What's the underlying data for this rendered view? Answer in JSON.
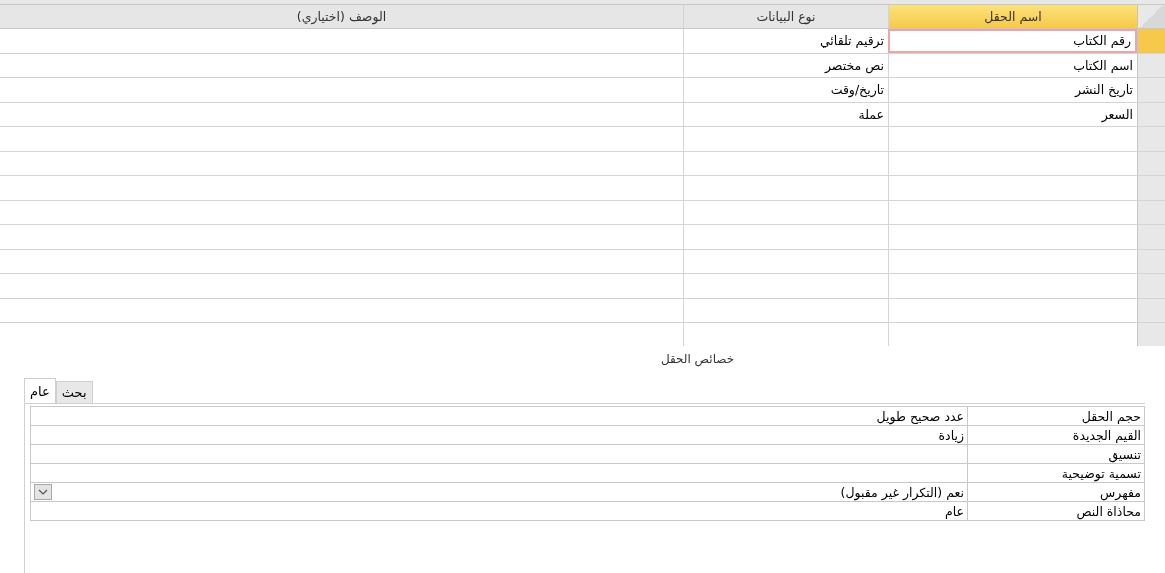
{
  "table_design": {
    "columns": [
      {
        "label": "اسم الحقل",
        "selected": true
      },
      {
        "label": "نوع البيانات",
        "selected": false
      },
      {
        "label": "الوصف (اختياري)",
        "selected": false
      }
    ],
    "rows": [
      {
        "field_name": "رقم الكتاب",
        "data_type": "ترقيم تلقائي",
        "selected": true
      },
      {
        "field_name": "اسم الكتاب",
        "data_type": "نص مختصر",
        "selected": false
      },
      {
        "field_name": "تاريخ النشر",
        "data_type": "تاريخ/وقت",
        "selected": false
      },
      {
        "field_name": "السعر",
        "data_type": "عملة",
        "selected": false
      }
    ]
  },
  "field_properties": {
    "title": "خصائص الحقل",
    "tabs": [
      {
        "label": "بحث",
        "selected": false
      },
      {
        "label": "عام",
        "selected": true
      }
    ],
    "properties": [
      {
        "label": "حجم الحقل",
        "value": "عدد صحيح طويل",
        "kind": "text"
      },
      {
        "label": "القيم الجديدة",
        "value": "زيادة",
        "kind": "text"
      },
      {
        "label": "تنسيق",
        "kind": "text"
      },
      {
        "label": "تسمية توضيحية",
        "kind": "text"
      },
      {
        "label": "مفهرس",
        "value": "نعم (التكرار غير مقبول)",
        "kind": "combo"
      },
      {
        "label": "محاذاة النص",
        "value": "عام",
        "kind": "text"
      }
    ]
  }
}
